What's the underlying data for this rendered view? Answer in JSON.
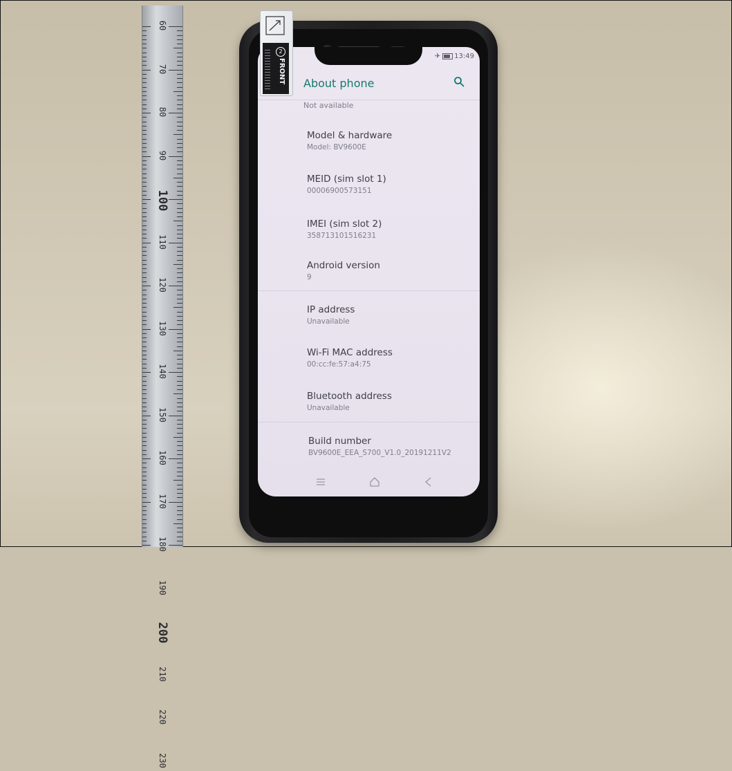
{
  "ruler": {
    "numbers": [
      "60",
      "70",
      "80",
      "90",
      "100",
      "110",
      "120",
      "130",
      "140",
      "150",
      "160",
      "170",
      "180",
      "190",
      "200",
      "210",
      "220",
      "230"
    ]
  },
  "protector_tab": {
    "label": "FRONT",
    "step": "2"
  },
  "status_bar": {
    "time": "13:49"
  },
  "app_bar": {
    "title": "About phone"
  },
  "list": {
    "truncated_value": "Not available",
    "items": [
      {
        "title": "Model & hardware",
        "summary": "Model: BV9600E"
      },
      {
        "title": "MEID (sim slot 1)",
        "summary": "00006900573151"
      },
      {
        "title": "IMEI (sim slot 2)",
        "summary": "358713101516231"
      },
      {
        "title": "Android version",
        "summary": "9"
      },
      {
        "title": "IP address",
        "summary": "Unavailable"
      },
      {
        "title": "Wi-Fi MAC address",
        "summary": "00:cc:fe:57:a4:75"
      },
      {
        "title": "Bluetooth address",
        "summary": "Unavailable"
      },
      {
        "title": "Build number",
        "summary": "BV9600E_EEA_S700_V1.0_20191211V2"
      }
    ]
  },
  "icons": {
    "search": "search-icon",
    "recents": "recents-icon",
    "home": "home-icon",
    "back": "back-icon",
    "airplane": "airplane-icon",
    "battery": "battery-icon"
  },
  "colors": {
    "accent": "#157a6f",
    "screen_bg": "#ece6f1"
  }
}
